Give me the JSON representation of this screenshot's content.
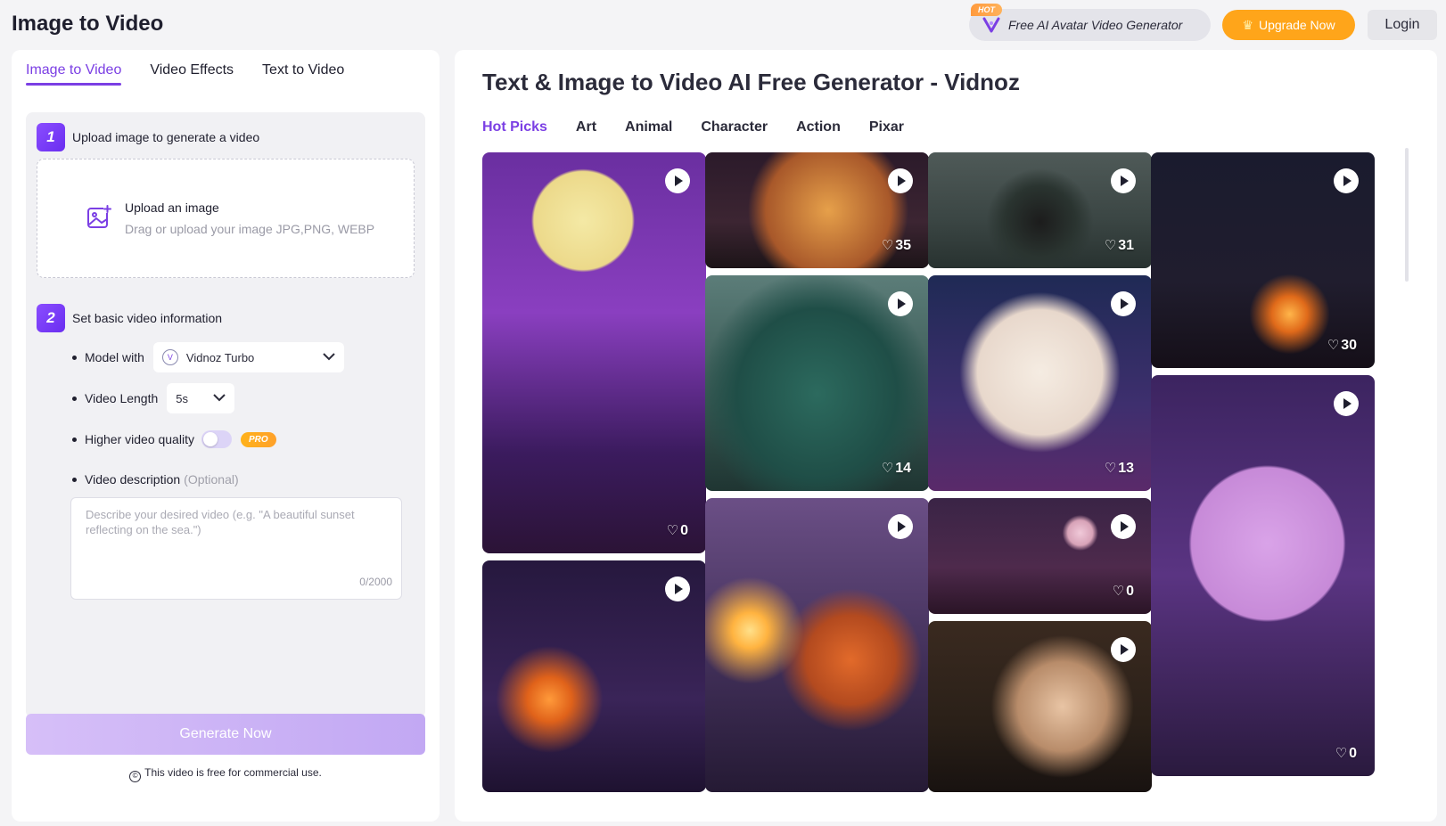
{
  "header": {
    "app_title": "Image to Video",
    "promo_hot": "HOT",
    "promo_text": "Free AI Avatar Video Generator",
    "upgrade_label": "Upgrade Now",
    "login_label": "Login"
  },
  "left": {
    "tabs": [
      "Image to Video",
      "Video Effects",
      "Text to Video"
    ],
    "active_tab": "Image to Video",
    "step1": {
      "num": "1",
      "label": "Upload image to generate a video"
    },
    "upload": {
      "title": "Upload an image",
      "hint": "Drag or upload your image JPG,PNG, WEBP"
    },
    "step2": {
      "num": "2",
      "label": "Set basic video information"
    },
    "model": {
      "label": "Model with",
      "value": "Vidnoz Turbo"
    },
    "length": {
      "label": "Video Length",
      "value": "5s"
    },
    "quality": {
      "label": "Higher video quality",
      "badge": "PRO",
      "enabled": false
    },
    "description": {
      "label": "Video description",
      "optional": "(Optional)",
      "placeholder": "Describe your desired video (e.g. \"A beautiful sunset reflecting on the sea.\")",
      "count": "0/2000"
    },
    "generate_label": "Generate Now",
    "free_note": "This video is free for commercial use."
  },
  "right": {
    "title": "Text & Image to Video AI Free Generator - Vidnoz",
    "categories": [
      "Hot Picks",
      "Art",
      "Animal",
      "Character",
      "Action",
      "Pixar"
    ],
    "active_category": "Hot Picks",
    "cards": [
      {
        "likes": "0"
      },
      {
        "likes": "35"
      },
      {
        "likes": "31"
      },
      {
        "likes": "30"
      },
      {
        "likes": "14"
      },
      {
        "likes": "13"
      },
      {
        "likes": "0"
      },
      {
        "likes": ""
      },
      {
        "likes": ""
      },
      {
        "likes": "0"
      },
      {
        "likes": ""
      }
    ]
  },
  "colors": {
    "accent": "#7b3fe4",
    "upgrade": "#ffa51a",
    "generate_disabled": "#c9b1f5"
  }
}
